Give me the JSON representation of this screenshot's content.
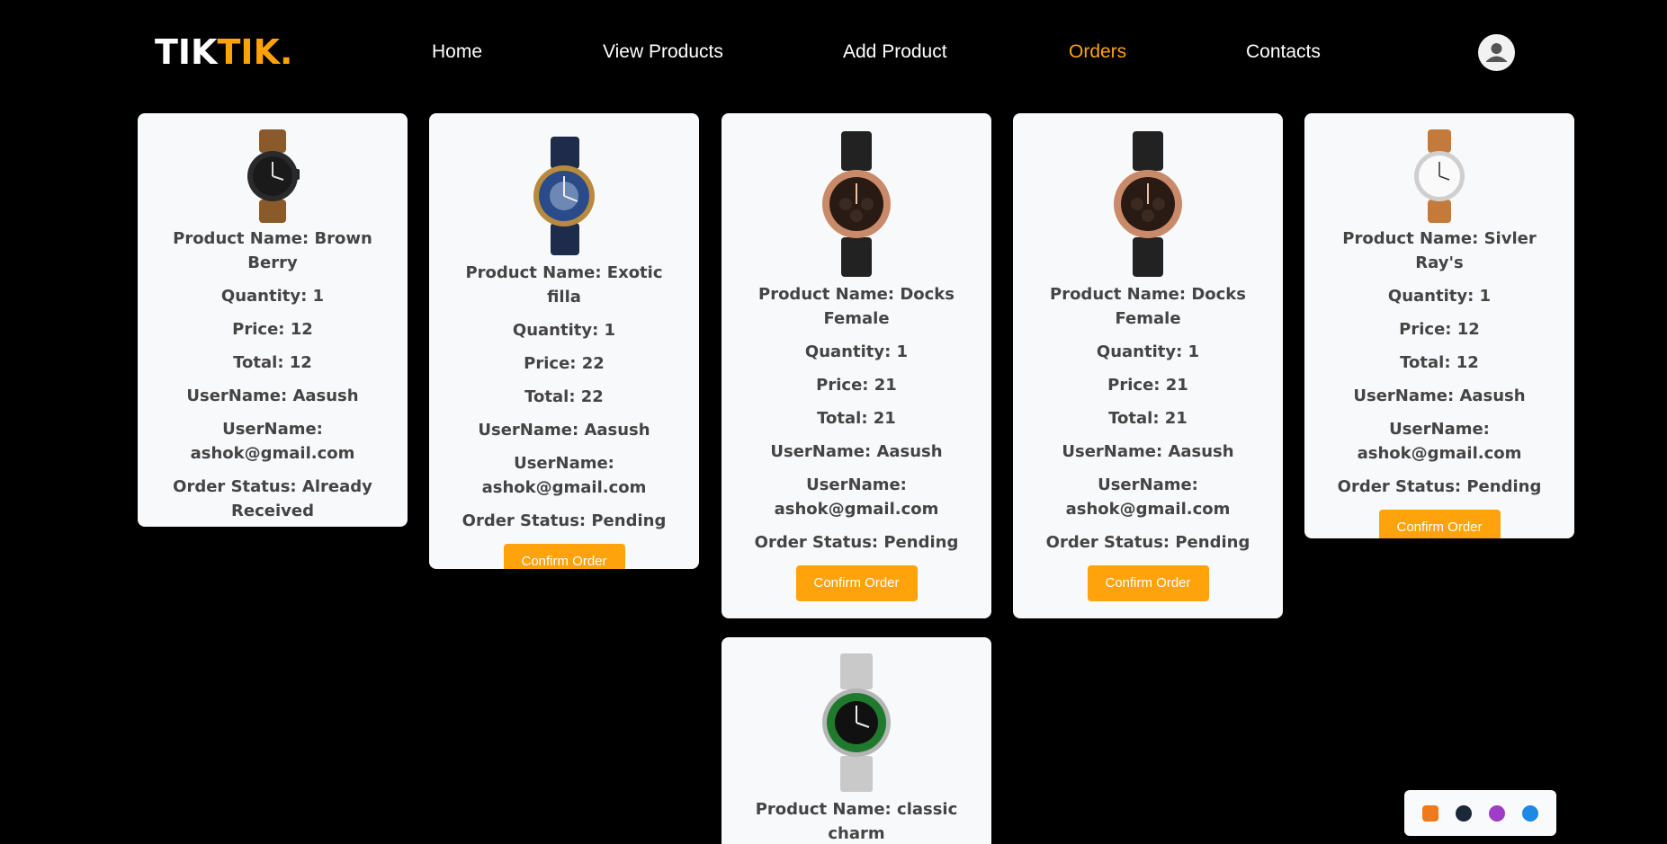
{
  "brand": {
    "part1": "TIK",
    "part2": "TIK."
  },
  "nav": {
    "home": "Home",
    "view_products": "View Products",
    "add_product": "Add Product",
    "orders": "Orders",
    "contacts": "Contacts"
  },
  "orders": [
    {
      "product": "Product Name: Brown Berry",
      "quantity": "Quantity: 1",
      "price": "Price: 12",
      "total": "Total: 12",
      "username": "UserName: Aasush",
      "email": "UserName: ashok@gmail.com",
      "status": "Order Status: Already Received"
    },
    {
      "product": "Product Name: Exotic filla",
      "quantity": "Quantity: 1",
      "price": "Price: 22",
      "total": "Total: 22",
      "username": "UserName: Aasush",
      "email": "UserName: ashok@gmail.com",
      "status": "Order Status: Pending",
      "button": "Confirm Order"
    },
    {
      "product": "Product Name: Docks Female",
      "quantity": "Quantity: 1",
      "price": "Price: 21",
      "total": "Total: 21",
      "username": "UserName: Aasush",
      "email": "UserName: ashok@gmail.com",
      "status": "Order Status: Pending",
      "button": "Confirm Order"
    },
    {
      "product": "Product Name: Docks Female",
      "quantity": "Quantity: 1",
      "price": "Price: 21",
      "total": "Total: 21",
      "username": "UserName: Aasush",
      "email": "UserName: ashok@gmail.com",
      "status": "Order Status: Pending",
      "button": "Confirm Order"
    },
    {
      "product": "Product Name: Sivler Ray's",
      "quantity": "Quantity: 1",
      "price": "Price: 12",
      "total": "Total: 12",
      "username": "UserName: Aasush",
      "email": "UserName: ashok@gmail.com",
      "status": "Order Status: Pending",
      "button": "Confirm Order"
    },
    {
      "product": "Product Name: classic charm"
    }
  ],
  "colors": {
    "accent": "#ffa20a",
    "card_bg": "#f8f9fa",
    "page_bg": "#000000"
  },
  "tray_icons": [
    "xampp-icon",
    "steam-icon",
    "firefox-icon",
    "bluetooth-icon"
  ]
}
